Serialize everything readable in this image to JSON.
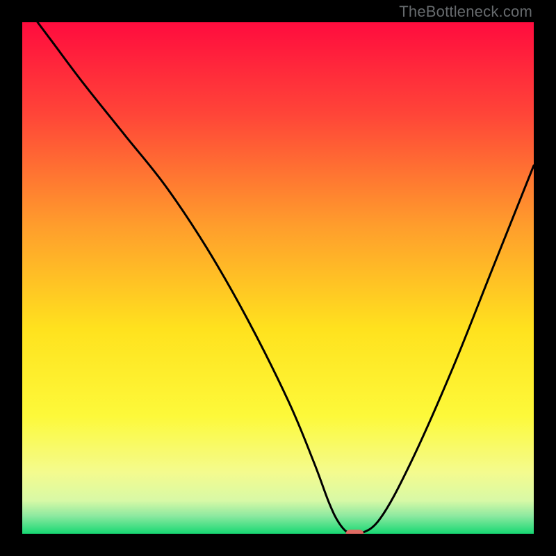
{
  "watermark": "TheBottleneck.com",
  "chart_data": {
    "type": "line",
    "title": "",
    "xlabel": "",
    "ylabel": "",
    "xlim": [
      0,
      100
    ],
    "ylim": [
      0,
      100
    ],
    "grid": false,
    "legend": false,
    "background_gradient_stops": [
      {
        "pos": 0.0,
        "color": "#ff0c3e"
      },
      {
        "pos": 0.18,
        "color": "#ff4538"
      },
      {
        "pos": 0.4,
        "color": "#ff9e2c"
      },
      {
        "pos": 0.6,
        "color": "#ffe21e"
      },
      {
        "pos": 0.77,
        "color": "#fdf93a"
      },
      {
        "pos": 0.88,
        "color": "#f4fb8e"
      },
      {
        "pos": 0.935,
        "color": "#d8f9a6"
      },
      {
        "pos": 0.965,
        "color": "#8de9a0"
      },
      {
        "pos": 1.0,
        "color": "#17d873"
      }
    ],
    "series": [
      {
        "name": "bottleneck-curve",
        "color": "#000000",
        "x": [
          3,
          6,
          12,
          20,
          28,
          36,
          44,
          52,
          57,
          60,
          62,
          64,
          66,
          70,
          76,
          84,
          92,
          100
        ],
        "y": [
          100,
          96,
          88,
          78,
          68,
          56,
          42,
          26,
          14,
          6,
          2,
          0,
          0,
          3,
          14,
          32,
          52,
          72
        ]
      }
    ],
    "marker": {
      "name": "optimal-point",
      "x": 65,
      "y": 0,
      "color": "#e06a63",
      "width": 3.5,
      "height": 1.6
    }
  }
}
